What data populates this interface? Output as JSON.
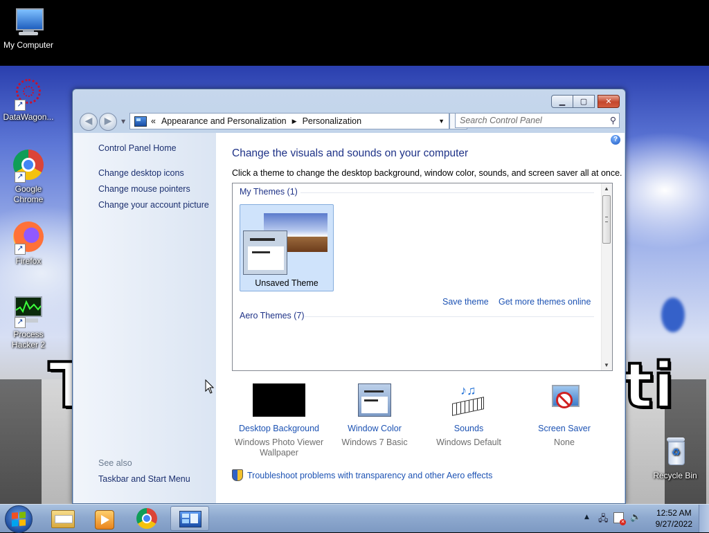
{
  "desktop": {
    "icons": [
      {
        "label": "My Computer"
      },
      {
        "label": "DataWagon..."
      },
      {
        "label": "Google Chrome"
      },
      {
        "label": "Firefox"
      },
      {
        "label": "Process Hacker 2"
      },
      {
        "label": "Recycle Bin"
      }
    ]
  },
  "window": {
    "address": {
      "segments": [
        "Appearance and Personalization",
        "Personalization"
      ],
      "overflow": "«"
    },
    "search": {
      "placeholder": "Search Control Panel"
    },
    "left_pane": {
      "home": "Control Panel Home",
      "links": [
        "Change desktop icons",
        "Change mouse pointers",
        "Change your account picture"
      ],
      "see_also_title": "See also",
      "see_also_links": [
        "Taskbar and Start Menu"
      ]
    },
    "main": {
      "heading": "Change the visuals and sounds on your computer",
      "subheading": "Click a theme to change the desktop background, window color, sounds, and screen saver all at once.",
      "my_themes_title": "My Themes (1)",
      "selected_theme": "Unsaved Theme",
      "save_theme": "Save theme",
      "get_more": "Get more themes online",
      "aero_themes_title": "Aero Themes (7)",
      "settings": [
        {
          "label": "Desktop Background",
          "value": "Windows Photo Viewer Wallpaper"
        },
        {
          "label": "Window Color",
          "value": "Windows 7 Basic"
        },
        {
          "label": "Sounds",
          "value": "Windows Default"
        },
        {
          "label": "Screen Saver",
          "value": "None"
        }
      ],
      "troubleshoot": "Troubleshoot problems with transparency and other Aero effects"
    }
  },
  "taskbar": {
    "time": "12:52 AM",
    "date": "9/27/2022",
    "apps": [
      "windows-explorer",
      "windows-media-player",
      "google-chrome",
      "control-panel"
    ]
  }
}
